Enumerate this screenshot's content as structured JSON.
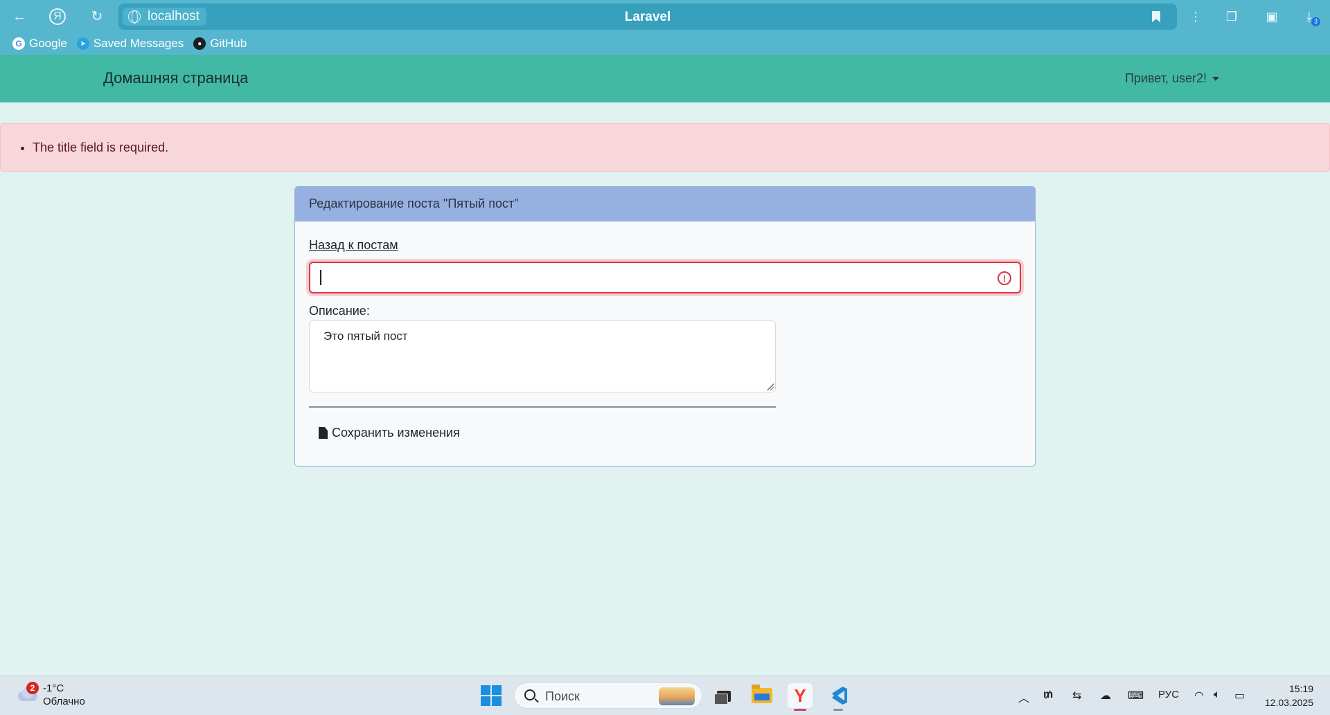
{
  "browser": {
    "address": "localhost",
    "page_title": "Laravel",
    "bookmarks": [
      {
        "label": "Google",
        "icon": "google-icon"
      },
      {
        "label": "Saved Messages",
        "icon": "telegram-icon"
      },
      {
        "label": "GitHub",
        "icon": "github-icon"
      }
    ],
    "downloads_badge": "3"
  },
  "navbar": {
    "brand": "Домашняя страница",
    "user_greeting": "Привет, user2!"
  },
  "alert": {
    "errors": [
      "The title field is required."
    ]
  },
  "card": {
    "header": "Редактирование поста \"Пятый пост\"",
    "back_link": "Назад к постам",
    "title_input_value": "",
    "description_label": "Описание:",
    "description_value": "Это пятый пост",
    "save_button": "Сохранить изменения"
  },
  "taskbar": {
    "weather_badge": "2",
    "temperature": "-1°C",
    "weather_desc": "Облачно",
    "search_placeholder": "Поиск",
    "language": "РУС",
    "time": "15:19",
    "date": "12.03.2025"
  },
  "colors": {
    "navbar": "#41b9a5",
    "page_bg": "#e0f3f1",
    "alert_bg": "#f8d7da",
    "card_header": "#96b1e0",
    "error": "#dc3545",
    "browser_bar": "#56b6cd"
  }
}
